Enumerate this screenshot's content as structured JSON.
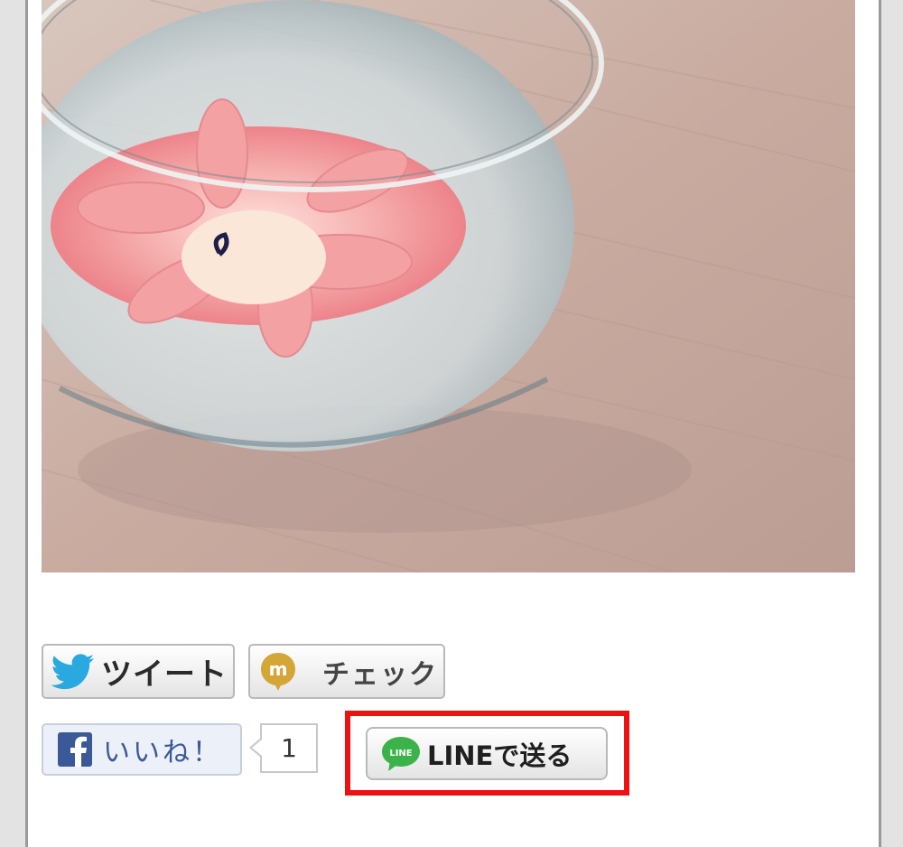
{
  "share": {
    "tweet": {
      "label": "ツイート",
      "icon": "twitter-bird-icon",
      "color": "#2aa9e0"
    },
    "check": {
      "label": "チェック",
      "icon": "mixi-check-icon",
      "color": "#d4a537"
    },
    "like": {
      "label": "いいね！",
      "icon": "facebook-icon",
      "color": "#3b5998",
      "count": "1"
    },
    "line": {
      "label": "LINEで送る",
      "icon": "line-icon",
      "icon_text": "LINE",
      "color": "#3bb34a"
    }
  },
  "colors": {
    "highlight": "#ee1111"
  }
}
